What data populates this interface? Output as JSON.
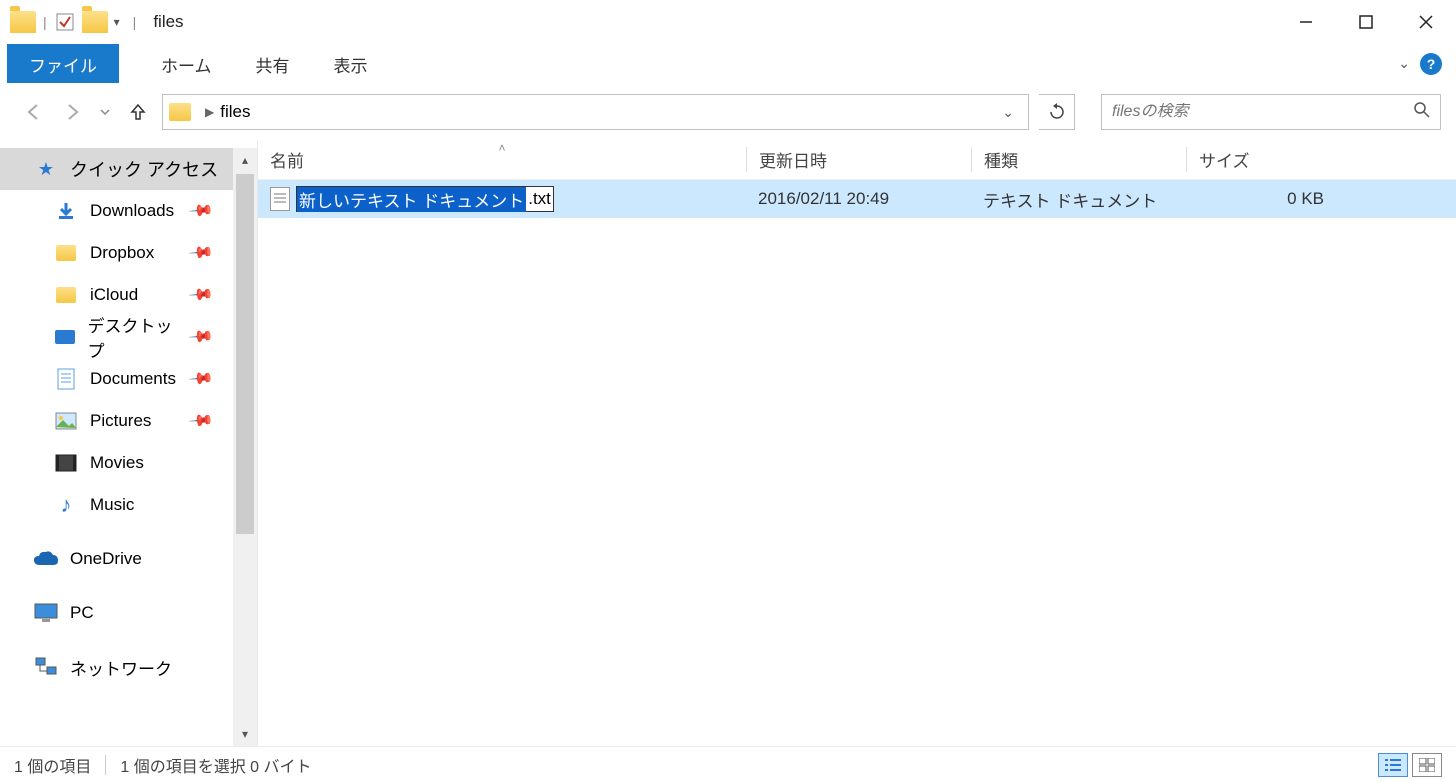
{
  "titlebar": {
    "title": "files"
  },
  "ribbon": {
    "file": "ファイル",
    "home": "ホーム",
    "share": "共有",
    "view": "表示"
  },
  "address": {
    "crumb": "files"
  },
  "search": {
    "placeholder": "filesの検索"
  },
  "sidebar": {
    "quick_access": "クイック アクセス",
    "items": [
      {
        "label": "Downloads",
        "pinned": true,
        "icon": "download"
      },
      {
        "label": "Dropbox",
        "pinned": true,
        "icon": "folder-y"
      },
      {
        "label": "iCloud",
        "pinned": true,
        "icon": "folder-y"
      },
      {
        "label": "デスクトップ",
        "pinned": true,
        "icon": "desktop"
      },
      {
        "label": "Documents",
        "pinned": true,
        "icon": "document"
      },
      {
        "label": "Pictures",
        "pinned": true,
        "icon": "picture"
      },
      {
        "label": "Movies",
        "pinned": false,
        "icon": "movie"
      },
      {
        "label": "Music",
        "pinned": false,
        "icon": "music"
      }
    ],
    "onedrive": "OneDrive",
    "pc": "PC",
    "network": "ネットワーク"
  },
  "columns": {
    "name": "名前",
    "date": "更新日時",
    "type": "種類",
    "size": "サイズ"
  },
  "file": {
    "name_selected": "新しいテキスト ドキュメント",
    "name_ext": ".txt",
    "date": "2016/02/11 20:49",
    "type": "テキスト ドキュメント",
    "size": "0 KB"
  },
  "status": {
    "count": "1 個の項目",
    "selection": "1 個の項目を選択 0 バイト"
  }
}
